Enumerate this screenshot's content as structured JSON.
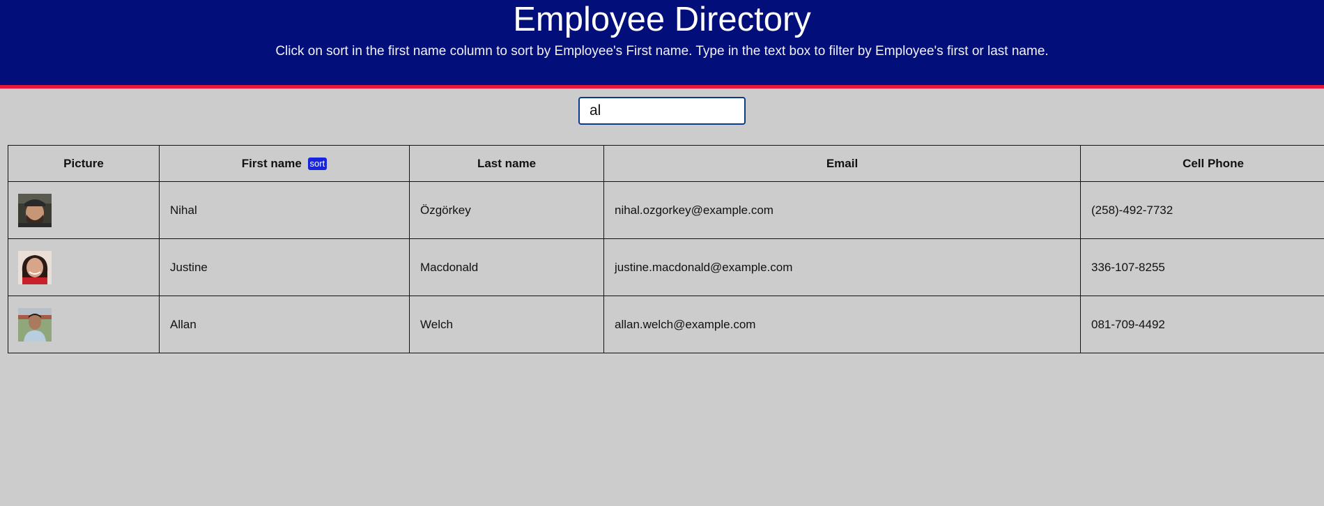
{
  "header": {
    "title": "Employee Directory",
    "subtitle": "Click on sort in the first name column to sort by Employee's First name. Type in the text box to filter by Employee's first or last name."
  },
  "search": {
    "value": "al"
  },
  "table": {
    "columns": {
      "picture": "Picture",
      "first_name": "First name",
      "sort_label": "sort",
      "last_name": "Last name",
      "email": "Email",
      "cell_phone": "Cell Phone"
    },
    "rows": [
      {
        "first": "Nihal",
        "last": "Özgörkey",
        "email": "nihal.ozgorkey@example.com",
        "phone": "(258)-492-7732"
      },
      {
        "first": "Justine",
        "last": "Macdonald",
        "email": "justine.macdonald@example.com",
        "phone": "336-107-8255"
      },
      {
        "first": "Allan",
        "last": "Welch",
        "email": "allan.welch@example.com",
        "phone": "081-709-4492"
      }
    ]
  },
  "colors": {
    "header_bg": "#020e7a",
    "header_border": "#e8173c",
    "page_bg": "#cccccc",
    "sort_button": "#1725e0"
  }
}
